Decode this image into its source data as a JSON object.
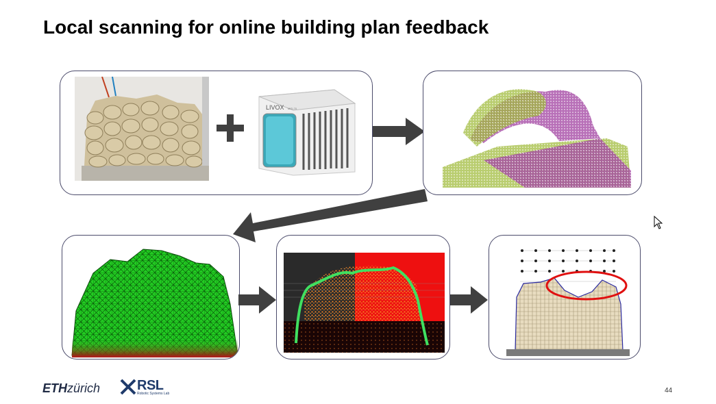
{
  "slide": {
    "title": "Local scanning for online building plan feedback",
    "page_number": "44"
  },
  "footer": {
    "eth_bold": "ETH",
    "eth_rest": "zürich",
    "rsl_name": "RSL",
    "rsl_subtitle": "Robotic Systems Lab"
  },
  "sensor": {
    "brand": "LIVOX",
    "model": "MID-70"
  },
  "colors": {
    "panel_border": "#4a4a6a",
    "arrow": "#404040",
    "cloud_green": "#9bb832",
    "cloud_purple": "#a040a0",
    "mesh_green": "#22cc22",
    "highlight_red": "#e01010"
  }
}
